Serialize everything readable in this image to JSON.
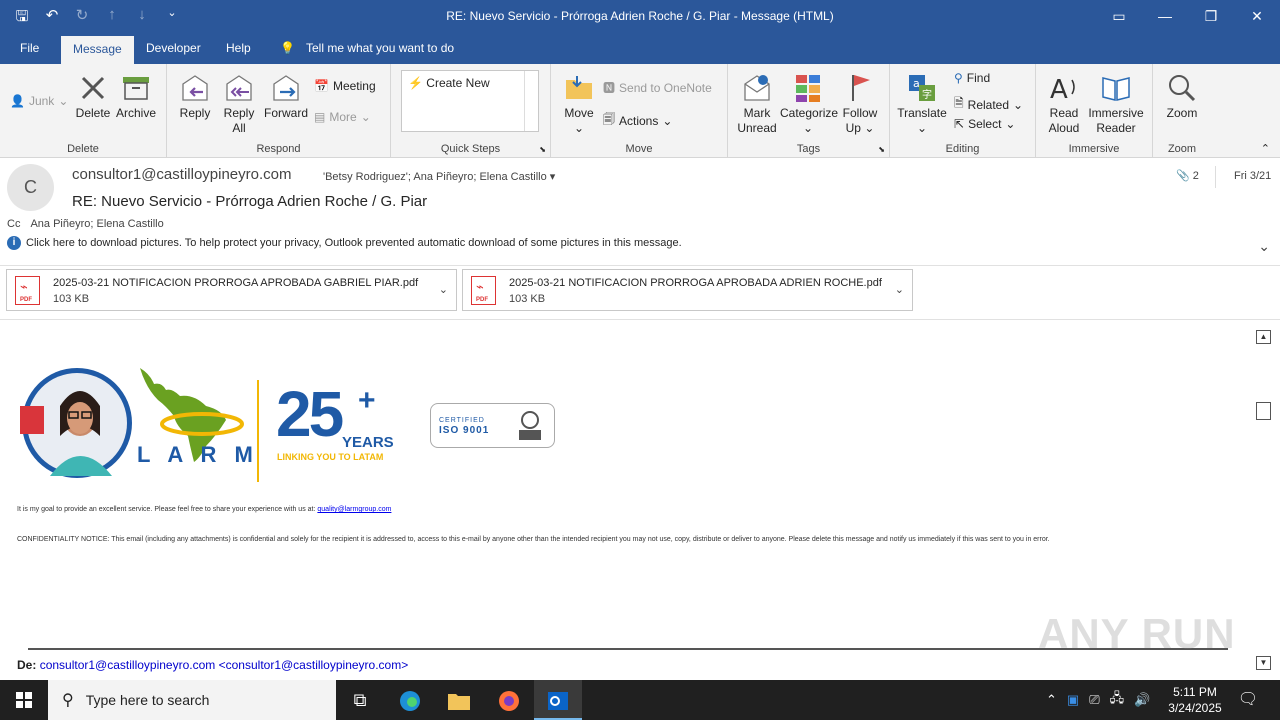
{
  "window": {
    "title": "RE: Nuevo Servicio - Prórroga Adrien Roche / G. Piar  -  Message (HTML)"
  },
  "tabs": [
    {
      "label": "File"
    },
    {
      "label": "Message"
    },
    {
      "label": "Developer"
    },
    {
      "label": "Help"
    },
    {
      "label": "Tell me what you want to do"
    }
  ],
  "ribbon": {
    "junk": "Junk",
    "delete": "Delete",
    "archive": "Archive",
    "group_delete": "Delete",
    "reply": "Reply",
    "reply_all_1": "Reply",
    "reply_all_2": "All",
    "forward": "Forward",
    "meeting": "Meeting",
    "more": "More",
    "group_respond": "Respond",
    "create_new": "Create New",
    "group_quicksteps": "Quick Steps",
    "move": "Move",
    "send_onenote": "Send to OneNote",
    "actions": "Actions",
    "group_move": "Move",
    "mark_unread_1": "Mark",
    "mark_unread_2": "Unread",
    "categorize": "Categorize",
    "follow_up_1": "Follow",
    "follow_up_2": "Up",
    "group_tags": "Tags",
    "translate": "Translate",
    "find": "Find",
    "related": "Related",
    "select": "Select",
    "group_editing": "Editing",
    "read_aloud_1": "Read",
    "read_aloud_2": "Aloud",
    "immersive_1": "Immersive",
    "immersive_2": "Reader",
    "group_immersive": "Immersive",
    "zoom": "Zoom",
    "group_zoom": "Zoom"
  },
  "message": {
    "avatar_initial": "C",
    "from": "consultor1@castilloypineyro.com",
    "to": "'Betsy  Rodriguez'; Ana Piñeyro; Elena Castillo",
    "attachment_count": "2",
    "date": "Fri 3/21",
    "subject": "RE: Nuevo Servicio - Prórroga Adrien Roche / G. Piar",
    "cc_label": "Cc",
    "cc": "Ana Piñeyro; Elena Castillo",
    "info_bar": "Click here to download pictures. To help protect your privacy, Outlook prevented automatic download of some pictures in this message."
  },
  "attachments": [
    {
      "name": "2025-03-21 NOTIFICACION PRORROGA APROBADA GABRIEL PIAR.pdf",
      "size": "103 KB"
    },
    {
      "name": "2025-03-21 NOTIFICACION PRORROGA APROBADA ADRIEN ROCHE.pdf",
      "size": "103 KB"
    }
  ],
  "body": {
    "larm_text": "L A R M",
    "years_number": "25",
    "years_plus": "+",
    "years_word": "YEARS",
    "years_tag": "LINKING YOU TO LATAM",
    "iso_certified": "CERTIFIED",
    "iso_label": "ISO 9001",
    "goal_text": "It is my goal to provide an excellent service. Please feel free to share your experience with us at:",
    "goal_link": "quality@larmgroup.com",
    "confidentiality": "CONFIDENTIALITY NOTICE: This email (including any attachments) is confidential and solely for the recipient it is addressed to, access to this e-mail by anyone other than the intended recipient you may not use, copy, distribute or deliver to anyone. Please delete this message and notify us immediately if this was sent to you in error.",
    "de_label": "De:",
    "de_name": "consultor1@castilloypineyro.com",
    "de_email": "<consultor1@castilloypineyro.com>"
  },
  "taskbar": {
    "search_placeholder": "Type here to search",
    "time": "5:11 PM",
    "date": "3/24/2025"
  },
  "watermark": "ANY RUN",
  "colors": {
    "accent": "#2b579a",
    "link": "#0000cc",
    "pdf_red": "#d33333",
    "larm_green": "#6aa121",
    "larm_blue": "#1f5aa6",
    "larm_yellow": "#f2b705"
  }
}
